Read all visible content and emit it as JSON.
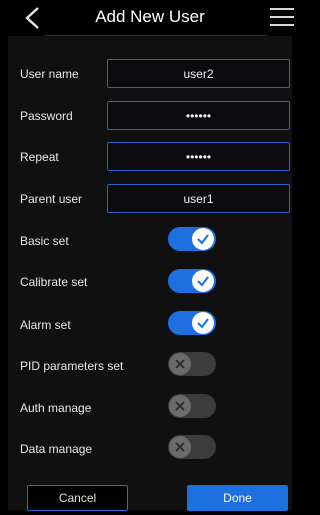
{
  "header": {
    "title": "Add New User",
    "back_icon": "chevron-left-icon",
    "menu_icon": "hamburger-menu-icon"
  },
  "fields": [
    {
      "label": "User name",
      "value": "user2"
    },
    {
      "label": "Password",
      "value": "••••••"
    },
    {
      "label": "Repeat",
      "value": "••••••"
    },
    {
      "label": "Parent user",
      "value": "user1"
    }
  ],
  "permissions": [
    {
      "label": "Basic set",
      "enabled": true
    },
    {
      "label": "Calibrate set",
      "enabled": true
    },
    {
      "label": "Alarm set",
      "enabled": true
    },
    {
      "label": "PID parameters set",
      "enabled": false
    },
    {
      "label": "Auth manage",
      "enabled": false
    },
    {
      "label": "Data manage",
      "enabled": false
    }
  ],
  "actions": {
    "cancel_label": "Cancel",
    "done_label": "Done"
  },
  "colors": {
    "accent": "#1e6fe0",
    "toggle_off": "#3c3c3c",
    "background": "#000000"
  }
}
